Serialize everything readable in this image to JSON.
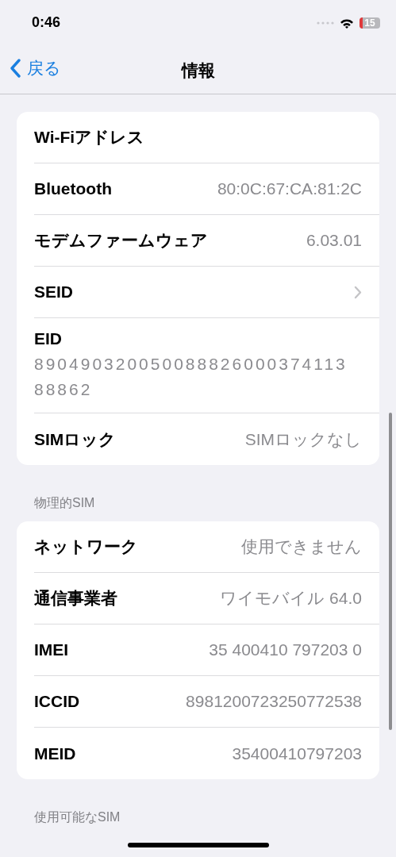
{
  "status_bar": {
    "time": "0:46",
    "battery": "15"
  },
  "nav": {
    "back": "戻る",
    "title": "情報"
  },
  "sections": [
    {
      "rows": [
        {
          "kind": "value",
          "label": "Wi-Fiアドレス"
        },
        {
          "kind": "value",
          "label": "Bluetooth",
          "value": "80:0C:67:CA:81:2C"
        },
        {
          "kind": "value",
          "label": "モデムファームウェア",
          "value": "6.03.01"
        },
        {
          "kind": "chevron",
          "label": "SEID"
        },
        {
          "kind": "stacked",
          "label": "EID",
          "value": "89049032005008882600037411388862"
        },
        {
          "kind": "value",
          "label": "SIMロック",
          "value": "SIMロックなし"
        }
      ]
    },
    {
      "header": "物理的SIM",
      "rows": [
        {
          "kind": "value",
          "label": "ネットワーク",
          "value": "使用できません"
        },
        {
          "kind": "value",
          "label": "通信事業者",
          "value": "ワイモバイル 64.0"
        },
        {
          "kind": "value",
          "label": "IMEI",
          "value": "35 400410 797203 0"
        },
        {
          "kind": "value",
          "label": "ICCID",
          "value": "8981200723250772538"
        },
        {
          "kind": "value",
          "label": "MEID",
          "value": "35400410797203"
        }
      ]
    },
    {
      "header": "使用可能なSIM"
    }
  ]
}
